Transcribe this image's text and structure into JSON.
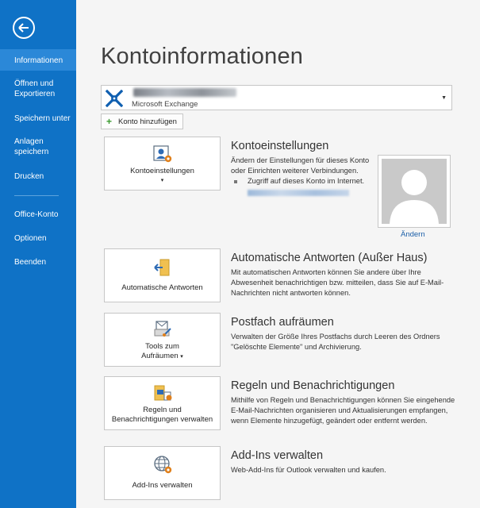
{
  "sidebar": {
    "back_icon": "arrow-left-icon",
    "items": [
      {
        "label": "Informationen",
        "active": true
      },
      {
        "label": "Öffnen und Exportieren"
      },
      {
        "label": "Speichern unter"
      },
      {
        "label": "Anlagen speichern"
      },
      {
        "label": "Drucken"
      },
      {
        "label": "Office-Konto"
      },
      {
        "label": "Optionen"
      },
      {
        "label": "Beenden"
      }
    ]
  },
  "main": {
    "title": "Kontoinformationen",
    "account": {
      "name": "M",
      "type": "Microsoft Exchange"
    },
    "add_account_label": "Konto hinzufügen",
    "sections": [
      {
        "tile_label": "Kontoeinstellungen",
        "tile_icon": "account-settings-icon",
        "title": "Kontoeinstellungen",
        "description": "Ändern der Einstellungen für dieses Konto oder Einrichten weiterer Verbindungen.",
        "bullet": "Zugriff auf dieses Konto im Internet.",
        "change_label": "Ändern"
      },
      {
        "tile_label": "Automatische Antworten",
        "tile_icon": "automatic-replies-icon",
        "title": "Automatische Antworten (Außer Haus)",
        "description": "Mit automatischen Antworten können Sie andere über Ihre Abwesenheit benachrichtigen bzw. mitteilen, dass Sie auf E-Mail-Nachrichten nicht antworten können."
      },
      {
        "tile_label_1": "Tools zum",
        "tile_label_2": "Aufräumen",
        "tile_icon": "cleanup-tools-icon",
        "title": "Postfach aufräumen",
        "description": "Verwalten der Größe Ihres Postfachs durch Leeren des Ordners \"Gelöschte Elemente\" und Archivierung."
      },
      {
        "tile_label_1": "Regeln und",
        "tile_label_2": "Benachrichtigungen verwalten",
        "tile_icon": "rules-alerts-icon",
        "title": "Regeln und Benachrichtigungen",
        "description": "Mithilfe von Regeln und Benachrichtigungen können Sie eingehende E-Mail-Nachrichten organisieren und Aktualisierungen empfangen, wenn Elemente hinzugefügt, geändert oder entfernt werden."
      },
      {
        "tile_label": "Add-Ins verwalten",
        "tile_icon": "addins-globe-icon",
        "title": "Add-Ins verwalten",
        "description": "Web-Add-Ins für Outlook verwalten und kaufen."
      }
    ]
  },
  "colors": {
    "sidebar": "#0f72c6",
    "sidebar_active": "#2b88d8",
    "link": "#1c5fa8",
    "background": "#f5f5f5"
  }
}
